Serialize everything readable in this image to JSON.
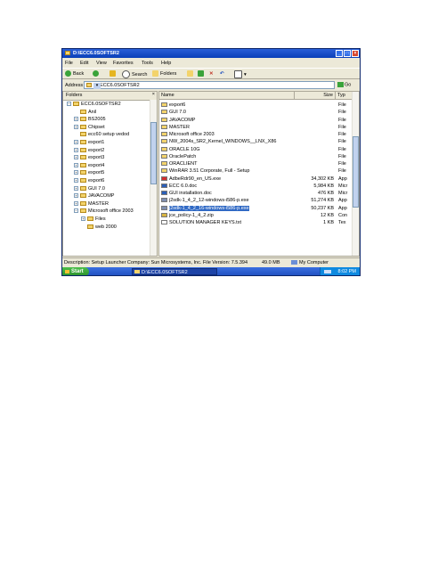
{
  "window": {
    "title": "D:\\ECC6.0SOFTSR2",
    "controls": [
      "_",
      "□",
      "×"
    ]
  },
  "menu": [
    "File",
    "Edit",
    "View",
    "Favorites",
    "Tools",
    "Help"
  ],
  "toolbar": {
    "back": "Back",
    "search": "Search",
    "folders": "Folders"
  },
  "address": {
    "label": "Address",
    "value": "D:\\ECC6.0SOFTSR2",
    "go": "Go"
  },
  "folders_pane": {
    "header": "Folders",
    "close": "×",
    "items": [
      {
        "label": "ECC6.0SOFTSR2",
        "pm": "−"
      },
      {
        "label": "Anil",
        "pm": ""
      },
      {
        "label": "BS2005",
        "pm": "+"
      },
      {
        "label": "Chipset",
        "pm": "+"
      },
      {
        "label": "ecc60 setup vedod",
        "pm": ""
      },
      {
        "label": "export1",
        "pm": "+"
      },
      {
        "label": "export2",
        "pm": "+"
      },
      {
        "label": "export3",
        "pm": "+"
      },
      {
        "label": "export4",
        "pm": "+"
      },
      {
        "label": "export5",
        "pm": "+"
      },
      {
        "label": "export6",
        "pm": "+"
      },
      {
        "label": "GUI 7.0",
        "pm": "+"
      },
      {
        "label": "JAVACOMP",
        "pm": "+"
      },
      {
        "label": "MASTER",
        "pm": "+"
      },
      {
        "label": "Microsoft office 2003",
        "pm": "−"
      },
      {
        "label": "Files",
        "pm": "+"
      },
      {
        "label": "web 2000",
        "pm": ""
      }
    ]
  },
  "files": {
    "columns": {
      "name": "Name",
      "size": "Size",
      "type": "Typ"
    },
    "rows": [
      {
        "name": "export6",
        "size": "",
        "type": "File",
        "kind": "folder"
      },
      {
        "name": "GUI 7.0",
        "size": "",
        "type": "File",
        "kind": "folder"
      },
      {
        "name": "JAVACOMP",
        "size": "",
        "type": "File",
        "kind": "folder"
      },
      {
        "name": "MASTER",
        "size": "",
        "type": "File",
        "kind": "folder"
      },
      {
        "name": "Microsoft office 2003",
        "size": "",
        "type": "File",
        "kind": "folder"
      },
      {
        "name": "NW_2004s_SR2_Kernel_WINDOWS__LNX_X86",
        "size": "",
        "type": "File",
        "kind": "folder"
      },
      {
        "name": "ORACLE 10G",
        "size": "",
        "type": "File",
        "kind": "folder"
      },
      {
        "name": "OraclePatch",
        "size": "",
        "type": "File",
        "kind": "folder"
      },
      {
        "name": "ORACLIENT",
        "size": "",
        "type": "File",
        "kind": "folder"
      },
      {
        "name": "WinRAR 3.51 Corporate, Full - Setup",
        "size": "",
        "type": "File",
        "kind": "folder"
      },
      {
        "name": "AdbeRdr90_en_US.exe",
        "size": "34,302 KB",
        "type": "App",
        "kind": "pdf"
      },
      {
        "name": "ECC 6.0.doc",
        "size": "5,984 KB",
        "type": "Micr",
        "kind": "doc"
      },
      {
        "name": "GUI installation.doc",
        "size": "476 KB",
        "type": "Micr",
        "kind": "doc"
      },
      {
        "name": "j2sdk-1_4_2_12-windows-i586-p.exe",
        "size": "51,274 KB",
        "type": "App",
        "kind": "exe"
      },
      {
        "name": "j2sdk-1_4_2_16-windows-i586-p.exe",
        "size": "50,237 KB",
        "type": "App",
        "kind": "exe",
        "selected": true
      },
      {
        "name": "jce_policy-1_4_2.zip",
        "size": "12 KB",
        "type": "Con",
        "kind": "zip"
      },
      {
        "name": "SOLUTION MANAGER KEYS.txt",
        "size": "1 KB",
        "type": "Tex",
        "kind": "txt"
      }
    ]
  },
  "status": {
    "description": "Description: Setup Launcher Company: Sun Microsystems, Inc. File Version: 7.5.394",
    "size": "49.0 MB",
    "location": "My Computer"
  },
  "taskbar": {
    "start": "Start",
    "task": "D:\\ECC6.0SOFTSR2",
    "clock": "8:02 PM"
  },
  "colors": {
    "titlebar": "#0a3fb8",
    "selection": "#316ac5",
    "folder": "#f3d36b",
    "start": "#2b8f2b"
  }
}
